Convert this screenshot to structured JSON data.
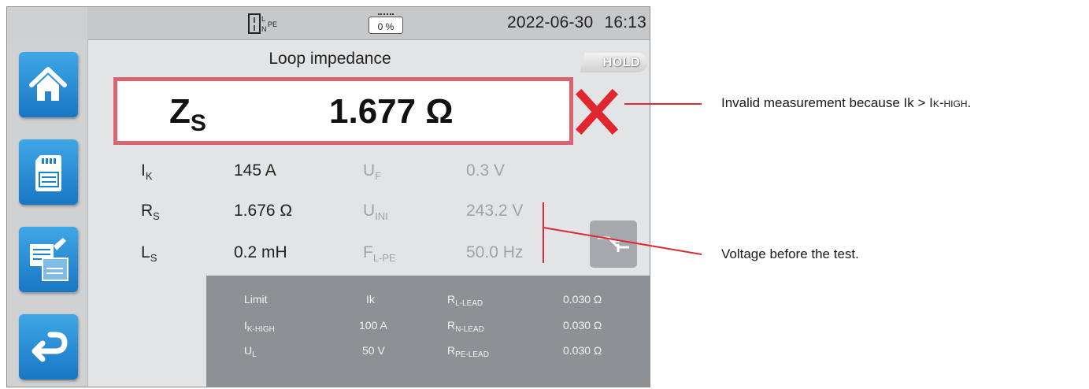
{
  "status_bar": {
    "plug_icon": "plug-l-n-pe-icon",
    "battery_level": "0 %",
    "date": "2022-06-30",
    "time": "16:13"
  },
  "sidebar": [
    {
      "name": "home-icon"
    },
    {
      "name": "save-sd-card-icon"
    },
    {
      "name": "notes-icon"
    },
    {
      "name": "back-arrow-icon"
    }
  ],
  "screen": {
    "title": "Loop impedance",
    "hold": "HOLD",
    "main": {
      "symbol": "Z",
      "symbol_sub": "S",
      "value": "1.677  Ω"
    },
    "status_icon": "invalid-cross-icon",
    "rows": [
      {
        "sym": "I",
        "sub": "K",
        "val": "145 A",
        "sym2": "U",
        "sub2": "F",
        "val2": "0.3 V"
      },
      {
        "sym": "R",
        "sub": "S",
        "val": "1.676 Ω",
        "sym2": "U",
        "sub2": "INI",
        "val2": "243.2 V"
      },
      {
        "sym": "L",
        "sub": "S",
        "val": "0.2 mH",
        "sym2": "F",
        "sub2": "L-PE",
        "val2": "50.0 Hz"
      }
    ],
    "limits": [
      {
        "a": "Limit",
        "a_sub": "",
        "b": "Ik",
        "c": "R",
        "c_sub": "L-LEAD",
        "d": "0.030 Ω"
      },
      {
        "a": "I",
        "a_sub": "K-HIGH",
        "b": "100 A",
        "c": "R",
        "c_sub": "N-LEAD",
        "d": "0.030 Ω"
      },
      {
        "a": "U",
        "a_sub": "L",
        "b": "50 V",
        "c": "R",
        "c_sub": "PE-LEAD",
        "d": "0.030 Ω"
      }
    ],
    "function_button": "loop-trip-icon"
  },
  "callouts": {
    "invalid_prefix": "Invalid measurement because Ik > I",
    "invalid_sc": "k-high",
    "invalid_suffix": ".",
    "voltage": "Voltage before the test."
  },
  "colors": {
    "accent": "#d92b35",
    "frame": "#d9646f",
    "button": "#2a8fd6"
  }
}
